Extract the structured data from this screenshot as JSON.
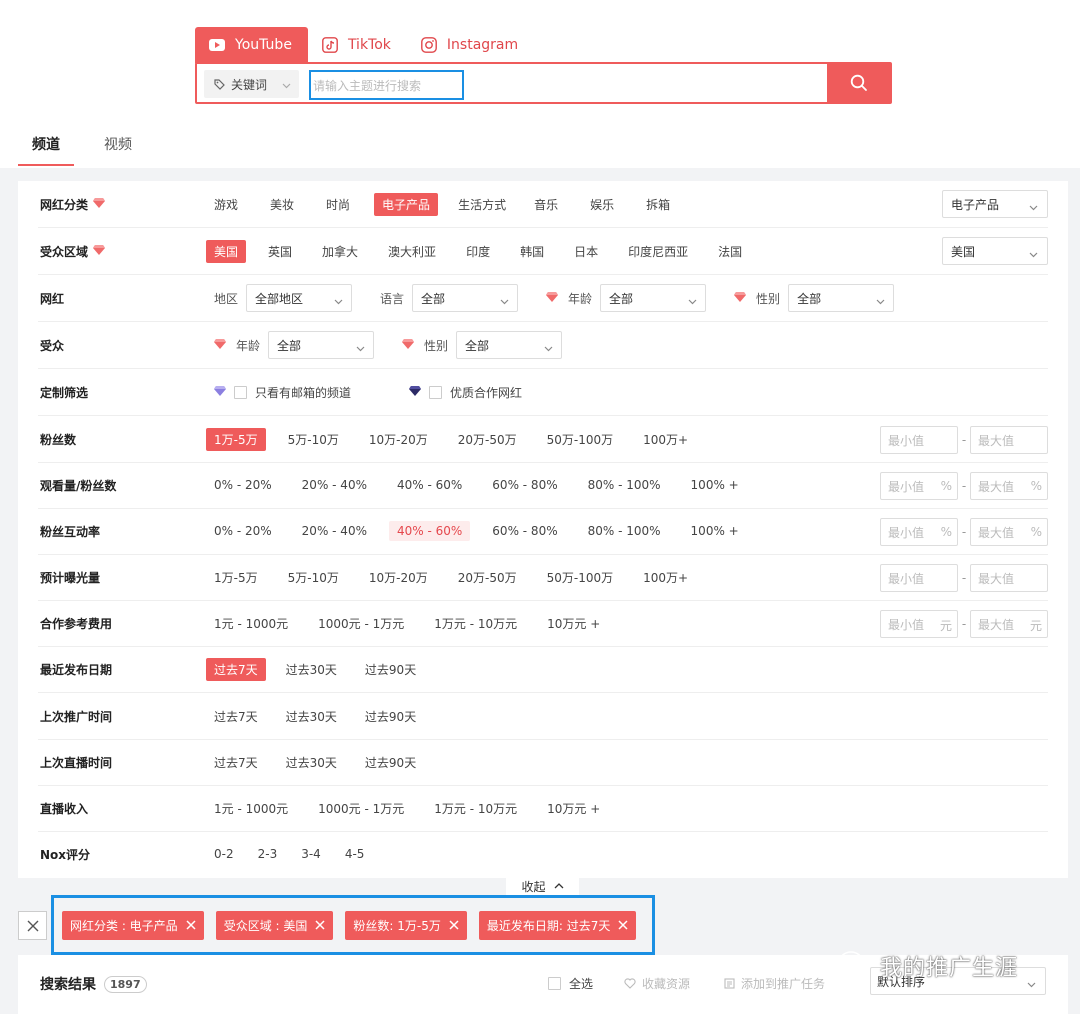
{
  "platforms": [
    {
      "label": "YouTube",
      "icon": "youtube-icon",
      "active": true
    },
    {
      "label": "TikTok",
      "icon": "tiktok-icon",
      "active": false
    },
    {
      "label": "Instagram",
      "icon": "instagram-icon",
      "active": false
    }
  ],
  "search": {
    "type_label": "关键词",
    "placeholder": "请输入主题进行搜索"
  },
  "view_tabs": [
    {
      "label": "频道",
      "active": true
    },
    {
      "label": "视频",
      "active": false
    }
  ],
  "filters": {
    "category": {
      "label": "网红分类",
      "options": [
        "游戏",
        "美妆",
        "时尚",
        "电子产品",
        "生活方式",
        "音乐",
        "娱乐",
        "拆箱"
      ],
      "selected": "电子产品",
      "dropdown": "电子产品"
    },
    "region": {
      "label": "受众区域",
      "options": [
        "美国",
        "英国",
        "加拿大",
        "澳大利亚",
        "印度",
        "韩国",
        "日本",
        "印度尼西亚",
        "法国"
      ],
      "selected": "美国",
      "dropdown": "美国"
    },
    "influencer": {
      "label": "网红",
      "region_label": "地区",
      "region_value": "全部地区",
      "lang_label": "语言",
      "lang_value": "全部",
      "age_label": "年龄",
      "age_value": "全部",
      "gender_label": "性别",
      "gender_value": "全部"
    },
    "audience": {
      "label": "受众",
      "age_label": "年龄",
      "age_value": "全部",
      "gender_label": "性别",
      "gender_value": "全部"
    },
    "custom": {
      "label": "定制筛选",
      "email_only": "只看有邮箱的频道",
      "quality": "优质合作网红"
    },
    "followers": {
      "label": "粉丝数",
      "options": [
        "1万-5万",
        "5万-10万",
        "10万-20万",
        "20万-50万",
        "50万-100万",
        "100万+"
      ],
      "selected": "1万-5万",
      "min": "最小值",
      "max": "最大值"
    },
    "view_ratio": {
      "label": "观看量/粉丝数",
      "options": [
        "0% - 20%",
        "20% - 40%",
        "40% - 60%",
        "60% - 80%",
        "80% - 100%",
        "100% +"
      ],
      "min": "最小值",
      "max": "最大值",
      "unit": "%"
    },
    "engagement": {
      "label": "粉丝互动率",
      "options": [
        "0% - 20%",
        "20% - 40%",
        "40% - 60%",
        "60% - 80%",
        "80% - 100%",
        "100% +"
      ],
      "hovered": "40% - 60%",
      "min": "最小值",
      "max": "最大值",
      "unit": "%"
    },
    "exposure": {
      "label": "预计曝光量",
      "options": [
        "1万-5万",
        "5万-10万",
        "10万-20万",
        "20万-50万",
        "50万-100万",
        "100万+"
      ],
      "min": "最小值",
      "max": "最大值"
    },
    "fee": {
      "label": "合作参考费用",
      "options": [
        "1元 - 1000元",
        "1000元 - 1万元",
        "1万元 - 10万元",
        "10万元 +"
      ],
      "min": "最小值",
      "max": "最大值",
      "unit": "元"
    },
    "recent_post": {
      "label": "最近发布日期",
      "options": [
        "过去7天",
        "过去30天",
        "过去90天"
      ],
      "selected": "过去7天"
    },
    "last_promo": {
      "label": "上次推广时间",
      "options": [
        "过去7天",
        "过去30天",
        "过去90天"
      ]
    },
    "last_live": {
      "label": "上次直播时间",
      "options": [
        "过去7天",
        "过去30天",
        "过去90天"
      ]
    },
    "live_income": {
      "label": "直播收入",
      "options": [
        "1元 - 1000元",
        "1000元 - 1万元",
        "1万元 - 10万元",
        "10万元 +"
      ]
    },
    "nox_score": {
      "label": "Nox评分",
      "options": [
        "0-2",
        "2-3",
        "3-4",
        "4-5"
      ]
    }
  },
  "collapse_label": "收起",
  "active_filters": [
    "网红分类 : 电子产品",
    "受众区域 : 美国",
    "粉丝数: 1万-5万",
    "最近发布日期: 过去7天"
  ],
  "results": {
    "title": "搜索结果",
    "count": "1897",
    "select_all": "全选",
    "save_resource": "收藏资源",
    "add_task": "添加到推广任务",
    "sort": "默认排序"
  },
  "watermark": "我的推广生涯",
  "colors": {
    "accent": "#ef5b5b",
    "highlight_border": "#1a8fe3"
  }
}
